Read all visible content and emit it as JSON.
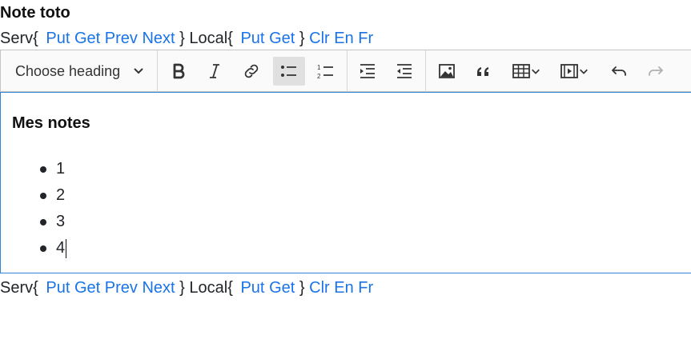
{
  "note_title": "Note toto",
  "nav": {
    "serv_open": "Serv{",
    "put": "Put",
    "get": "Get",
    "prev": "Prev",
    "next": "Next",
    "close1": "}",
    "local_open": "Local{",
    "local_put": "Put",
    "local_get": "Get",
    "close2": "}",
    "clr": "Clr",
    "en": "En",
    "fr": "Fr"
  },
  "toolbar": {
    "heading_label": "Choose heading",
    "icons": [
      "bold-icon",
      "italic-icon",
      "link-icon",
      "bulleted-list-icon",
      "numbered-list-icon",
      "indent-icon",
      "outdent-icon",
      "image-icon",
      "quote-icon",
      "table-icon",
      "media-icon",
      "undo-icon",
      "redo-icon"
    ],
    "active": "bulleted-list-icon"
  },
  "editor": {
    "heading": "Mes notes",
    "items": [
      "1",
      "2",
      "3",
      "4"
    ]
  },
  "colors": {
    "link": "#1a73e8",
    "focus_border": "#2f86d6",
    "active_button": "#e0e0e0"
  }
}
